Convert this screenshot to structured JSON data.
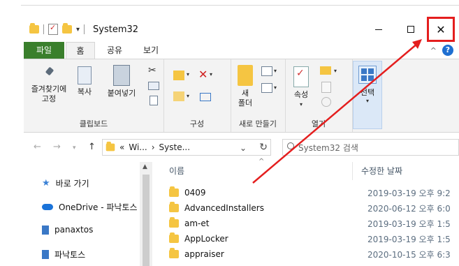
{
  "window": {
    "title": "System32",
    "controls": {
      "minimize": "—",
      "maximize": "□",
      "close": "✕"
    }
  },
  "ribbon_tabs": [
    "파일",
    "홈",
    "공유",
    "보기"
  ],
  "help": {
    "chevron": "^",
    "help_icon": "?"
  },
  "ribbon": {
    "clipboard": {
      "pin_label": "즐겨찾기에\n고정",
      "copy_label": "복사",
      "paste_label": "붙여넣기",
      "group_label": "클립보드"
    },
    "organize": {
      "group_label": "구성"
    },
    "new": {
      "new_folder_label": "새\n폴더",
      "group_label": "새로 만들기"
    },
    "open": {
      "properties_label": "속성",
      "group_label": "열기"
    },
    "select": {
      "select_label": "선택"
    }
  },
  "address": {
    "breadcrumb_prefix": "«",
    "crumb1": "Wi...",
    "crumb_sep": "›",
    "crumb2": "Syste...",
    "dropdown": "⌄",
    "refresh": "↻",
    "search_placeholder": "System32 검색"
  },
  "nav_pane": {
    "items": [
      {
        "label": "바로 가기",
        "icon": "star-icon"
      },
      {
        "label": "OneDrive - 파낙토스",
        "icon": "cloud-icon"
      },
      {
        "label": "panaxtos",
        "icon": "building-icon"
      },
      {
        "label": "파낙토스",
        "icon": "building-icon"
      }
    ]
  },
  "file_list": {
    "columns": {
      "name": "이름",
      "modified": "수정한 날짜"
    },
    "rows": [
      {
        "name": "0409",
        "date": "2019-03-19 오후 9:2"
      },
      {
        "name": "AdvancedInstallers",
        "date": "2020-06-12 오후 6:0"
      },
      {
        "name": "am-et",
        "date": "2019-03-19 오후 1:5"
      },
      {
        "name": "AppLocker",
        "date": "2019-03-19 오후 1:5"
      },
      {
        "name": "appraiser",
        "date": "2020-10-15 오후 6:3"
      }
    ]
  },
  "colors": {
    "file_tab": "#3a7f2c",
    "annotation": "#e41e1e",
    "accent": "#1e6fd1"
  }
}
